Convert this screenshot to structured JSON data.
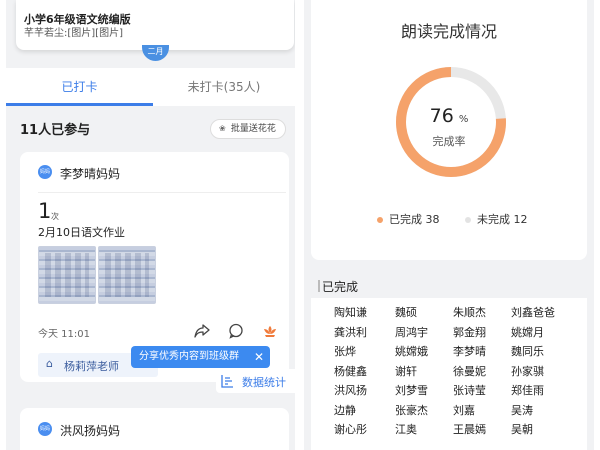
{
  "left": {
    "doc": {
      "title": "小学6年级语文统编版",
      "subtitle": "芊芊若尘:[图片][图片]"
    },
    "month_pill": "二月",
    "tabs": [
      {
        "label": "已打卡"
      },
      {
        "label": "未打卡(35人)"
      }
    ],
    "section": {
      "title": "11人已参与",
      "flower_button": "批量送花花"
    },
    "entry": {
      "badge": "妈妈",
      "name": "李梦晴妈妈",
      "count": "1",
      "count_unit": "次",
      "homework": "2月10日语文作业",
      "time": "今天 11:01",
      "teacher": "杨莉萍老师"
    },
    "tooltip": {
      "text": "分享优秀内容到班级群",
      "close": "✕"
    },
    "stats_button": "数据统计",
    "entry2": {
      "badge": "妈妈",
      "name": "洪风扬妈妈"
    },
    "icons": {
      "share": "share-icon",
      "comment": "comment-icon",
      "flower": "flower-icon",
      "teacher": "teacher-icon",
      "stats": "stats-icon"
    }
  },
  "right": {
    "title": "朗读完成情况",
    "percent": "76",
    "percent_sign": "%",
    "rate_label": "完成率",
    "legend": [
      {
        "label": "已完成 38",
        "color": "#f5a26a"
      },
      {
        "label": "未完成 12",
        "color": "#e8e8e8"
      }
    ],
    "done_header": "已完成",
    "names": [
      [
        "陶知谦",
        "魏硕",
        "朱顺杰",
        "刘鑫爸爸"
      ],
      [
        "龚洪利",
        "周鸿宇",
        "郭金翔",
        "姚嫦月"
      ],
      [
        "张烨",
        "姚嫦娥",
        "李梦晴",
        "魏同乐"
      ],
      [
        "杨健鑫",
        "谢轩",
        "徐曼妮",
        "孙家骐"
      ],
      [
        "洪风扬",
        "刘梦雪",
        "张诗莹",
        "郑佳雨"
      ],
      [
        "边静",
        "张豪杰",
        "刘嘉",
        "吴涛"
      ],
      [
        "谢心彤",
        "江奥",
        "王晨嫣",
        "吴朝"
      ]
    ]
  },
  "chart_data": {
    "type": "pie",
    "title": "朗读完成情况",
    "categories": [
      "已完成",
      "未完成"
    ],
    "values": [
      38,
      12
    ],
    "center_text": "76 %",
    "center_label": "完成率",
    "colors": [
      "#f5a26a",
      "#e8e8e8"
    ]
  }
}
